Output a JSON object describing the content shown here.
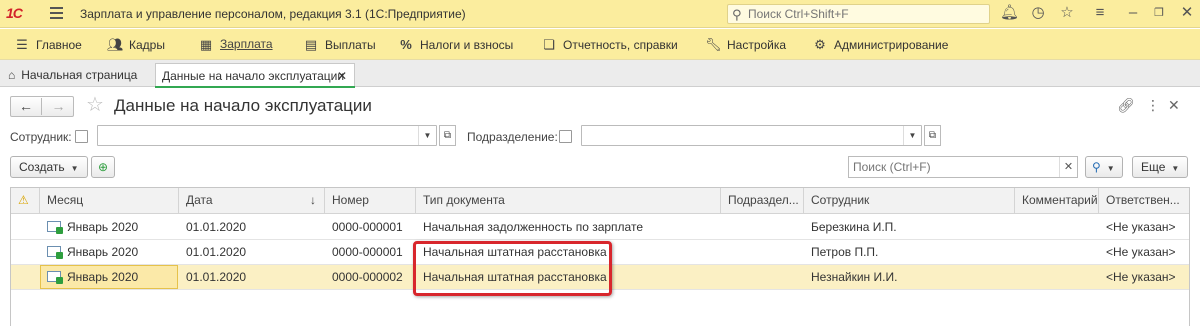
{
  "app": {
    "logo_text": "1С",
    "title": "Зарплата и управление персоналом, редакция 3.1  (1С:Предприятие)",
    "search_placeholder": "Поиск Ctrl+Shift+F"
  },
  "main_menu": [
    {
      "label": "Главное",
      "icon": "hamburger-icon"
    },
    {
      "label": "Кадры",
      "icon": "users-icon"
    },
    {
      "label": "Зарплата",
      "icon": "calculator-icon"
    },
    {
      "label": "Выплаты",
      "icon": "list-icon"
    },
    {
      "label": "Налоги и взносы",
      "icon": "percent-icon"
    },
    {
      "label": "Отчетность, справки",
      "icon": "reports-icon"
    },
    {
      "label": "Настройка",
      "icon": "wrench-icon"
    },
    {
      "label": "Администрирование",
      "icon": "gear-icon"
    }
  ],
  "tabs": {
    "home": "Начальная страница",
    "current": "Данные на начало эксплуатации"
  },
  "form": {
    "title": "Данные на начало эксплуатации",
    "filter_employee_label": "Сотрудник:",
    "filter_department_label": "Подразделение:",
    "create_label": "Создать",
    "search_placeholder": "Поиск (Ctrl+F)",
    "more_label": "Еще"
  },
  "table": {
    "columns": [
      "Месяц",
      "Дата",
      "Номер",
      "Тип документа",
      "Подраздел...",
      "Сотрудник",
      "Комментарий",
      "Ответствен..."
    ],
    "sort_indicator": "↓",
    "rows": [
      {
        "month": "Январь 2020",
        "date": "01.01.2020",
        "number": "0000-000001",
        "doc_type": "Начальная задолженность по зарплате",
        "department": "",
        "employee": "Березкина И.П.",
        "comment": "",
        "responsible": "<Не указан>"
      },
      {
        "month": "Январь 2020",
        "date": "01.01.2020",
        "number": "0000-000001",
        "doc_type": "Начальная штатная расстановка",
        "department": "",
        "employee": "Петров П.П.",
        "comment": "",
        "responsible": "<Не указан>"
      },
      {
        "month": "Январь 2020",
        "date": "01.01.2020",
        "number": "0000-000002",
        "doc_type": "Начальная штатная расстановка",
        "department": "",
        "employee": "Незнайкин И.И.",
        "comment": "",
        "responsible": "<Не указан>"
      }
    ]
  },
  "colors": {
    "accent_yellow": "#fbed9e",
    "highlight_red": "#d8262c",
    "selected_row": "#fbf0c4",
    "active_tab_underline": "#32a852"
  }
}
